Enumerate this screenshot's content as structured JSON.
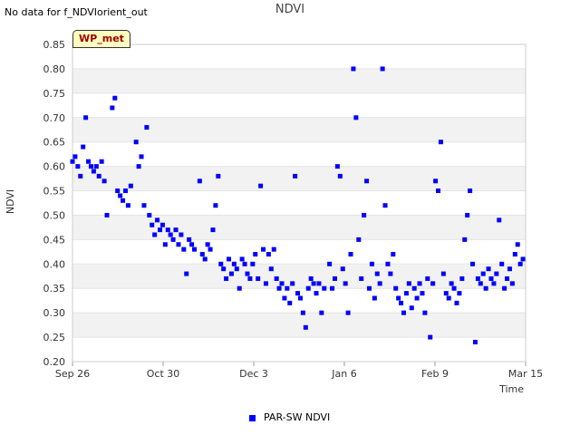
{
  "note": "No data for f_NDVIorient_out",
  "tag_label": "WP_met",
  "chart_data": {
    "type": "scatter",
    "title": "NDVI",
    "xlabel": "Time",
    "ylabel": "NDVI",
    "x_ticks": [
      "Sep 26",
      "Oct 30",
      "Dec 3",
      "Jan 6",
      "Feb 9",
      "Mar 15"
    ],
    "xlim": [
      "2023-09-26",
      "2024-03-15"
    ],
    "ylim": [
      0.2,
      0.85
    ],
    "y_ticks": [
      0.2,
      0.25,
      0.3,
      0.35,
      0.4,
      0.45,
      0.5,
      0.55,
      0.6,
      0.65,
      0.7,
      0.75,
      0.8,
      0.85
    ],
    "grid": "alternating horizontal bands",
    "legend_position": "bottom-center",
    "series": [
      {
        "name": "PAR-SW NDVI",
        "color": "#0000ff",
        "points": [
          [
            "2023-09-26",
            0.61
          ],
          [
            "2023-09-27",
            0.62
          ],
          [
            "2023-09-28",
            0.6
          ],
          [
            "2023-09-29",
            0.58
          ],
          [
            "2023-09-30",
            0.64
          ],
          [
            "2023-10-01",
            0.7
          ],
          [
            "2023-10-02",
            0.61
          ],
          [
            "2023-10-03",
            0.6
          ],
          [
            "2023-10-04",
            0.59
          ],
          [
            "2023-10-05",
            0.6
          ],
          [
            "2023-10-06",
            0.58
          ],
          [
            "2023-10-07",
            0.61
          ],
          [
            "2023-10-08",
            0.57
          ],
          [
            "2023-10-09",
            0.5
          ],
          [
            "2023-10-11",
            0.72
          ],
          [
            "2023-10-12",
            0.74
          ],
          [
            "2023-10-13",
            0.55
          ],
          [
            "2023-10-14",
            0.54
          ],
          [
            "2023-10-15",
            0.53
          ],
          [
            "2023-10-16",
            0.55
          ],
          [
            "2023-10-17",
            0.52
          ],
          [
            "2023-10-18",
            0.56
          ],
          [
            "2023-10-20",
            0.65
          ],
          [
            "2023-10-21",
            0.6
          ],
          [
            "2023-10-22",
            0.62
          ],
          [
            "2023-10-23",
            0.52
          ],
          [
            "2023-10-24",
            0.68
          ],
          [
            "2023-10-25",
            0.5
          ],
          [
            "2023-10-26",
            0.48
          ],
          [
            "2023-10-27",
            0.46
          ],
          [
            "2023-10-28",
            0.49
          ],
          [
            "2023-10-29",
            0.47
          ],
          [
            "2023-10-30",
            0.48
          ],
          [
            "2023-10-31",
            0.44
          ],
          [
            "2023-11-01",
            0.47
          ],
          [
            "2023-11-02",
            0.46
          ],
          [
            "2023-11-03",
            0.45
          ],
          [
            "2023-11-04",
            0.47
          ],
          [
            "2023-11-05",
            0.44
          ],
          [
            "2023-11-06",
            0.46
          ],
          [
            "2023-11-07",
            0.43
          ],
          [
            "2023-11-08",
            0.38
          ],
          [
            "2023-11-09",
            0.45
          ],
          [
            "2023-11-10",
            0.44
          ],
          [
            "2023-11-11",
            0.43
          ],
          [
            "2023-11-13",
            0.57
          ],
          [
            "2023-11-14",
            0.42
          ],
          [
            "2023-11-15",
            0.41
          ],
          [
            "2023-11-16",
            0.44
          ],
          [
            "2023-11-17",
            0.43
          ],
          [
            "2023-11-18",
            0.47
          ],
          [
            "2023-11-19",
            0.52
          ],
          [
            "2023-11-20",
            0.58
          ],
          [
            "2023-11-21",
            0.4
          ],
          [
            "2023-11-22",
            0.39
          ],
          [
            "2023-11-23",
            0.37
          ],
          [
            "2023-11-24",
            0.41
          ],
          [
            "2023-11-25",
            0.38
          ],
          [
            "2023-11-26",
            0.4
          ],
          [
            "2023-11-27",
            0.39
          ],
          [
            "2023-11-28",
            0.35
          ],
          [
            "2023-11-29",
            0.41
          ],
          [
            "2023-11-30",
            0.4
          ],
          [
            "2023-12-01",
            0.38
          ],
          [
            "2023-12-02",
            0.37
          ],
          [
            "2023-12-03",
            0.4
          ],
          [
            "2023-12-04",
            0.42
          ],
          [
            "2023-12-05",
            0.37
          ],
          [
            "2023-12-06",
            0.56
          ],
          [
            "2023-12-07",
            0.43
          ],
          [
            "2023-12-08",
            0.36
          ],
          [
            "2023-12-09",
            0.42
          ],
          [
            "2023-12-10",
            0.39
          ],
          [
            "2023-12-11",
            0.43
          ],
          [
            "2023-12-12",
            0.37
          ],
          [
            "2023-12-13",
            0.35
          ],
          [
            "2023-12-14",
            0.36
          ],
          [
            "2023-12-15",
            0.33
          ],
          [
            "2023-12-16",
            0.35
          ],
          [
            "2023-12-17",
            0.32
          ],
          [
            "2023-12-18",
            0.36
          ],
          [
            "2023-12-19",
            0.58
          ],
          [
            "2023-12-20",
            0.34
          ],
          [
            "2023-12-21",
            0.33
          ],
          [
            "2023-12-22",
            0.3
          ],
          [
            "2023-12-23",
            0.27
          ],
          [
            "2023-12-24",
            0.35
          ],
          [
            "2023-12-25",
            0.37
          ],
          [
            "2023-12-26",
            0.36
          ],
          [
            "2023-12-27",
            0.34
          ],
          [
            "2023-12-28",
            0.36
          ],
          [
            "2023-12-29",
            0.3
          ],
          [
            "2023-12-30",
            0.35
          ],
          [
            "2024-01-01",
            0.4
          ],
          [
            "2024-01-02",
            0.35
          ],
          [
            "2024-01-03",
            0.37
          ],
          [
            "2024-01-04",
            0.6
          ],
          [
            "2024-01-05",
            0.58
          ],
          [
            "2024-01-06",
            0.39
          ],
          [
            "2024-01-07",
            0.36
          ],
          [
            "2024-01-08",
            0.3
          ],
          [
            "2024-01-09",
            0.42
          ],
          [
            "2024-01-10",
            0.8
          ],
          [
            "2024-01-11",
            0.7
          ],
          [
            "2024-01-12",
            0.45
          ],
          [
            "2024-01-13",
            0.37
          ],
          [
            "2024-01-14",
            0.5
          ],
          [
            "2024-01-15",
            0.57
          ],
          [
            "2024-01-16",
            0.35
          ],
          [
            "2024-01-17",
            0.4
          ],
          [
            "2024-01-18",
            0.33
          ],
          [
            "2024-01-19",
            0.38
          ],
          [
            "2024-01-20",
            0.36
          ],
          [
            "2024-01-21",
            0.8
          ],
          [
            "2024-01-22",
            0.52
          ],
          [
            "2024-01-23",
            0.4
          ],
          [
            "2024-01-24",
            0.38
          ],
          [
            "2024-01-25",
            0.42
          ],
          [
            "2024-01-26",
            0.35
          ],
          [
            "2024-01-27",
            0.33
          ],
          [
            "2024-01-28",
            0.32
          ],
          [
            "2024-01-29",
            0.3
          ],
          [
            "2024-01-30",
            0.34
          ],
          [
            "2024-01-31",
            0.36
          ],
          [
            "2024-02-01",
            0.31
          ],
          [
            "2024-02-02",
            0.35
          ],
          [
            "2024-02-03",
            0.33
          ],
          [
            "2024-02-04",
            0.36
          ],
          [
            "2024-02-05",
            0.34
          ],
          [
            "2024-02-06",
            0.3
          ],
          [
            "2024-02-07",
            0.37
          ],
          [
            "2024-02-08",
            0.25
          ],
          [
            "2024-02-09",
            0.36
          ],
          [
            "2024-02-10",
            0.57
          ],
          [
            "2024-02-11",
            0.55
          ],
          [
            "2024-02-12",
            0.65
          ],
          [
            "2024-02-13",
            0.38
          ],
          [
            "2024-02-14",
            0.34
          ],
          [
            "2024-02-15",
            0.33
          ],
          [
            "2024-02-16",
            0.36
          ],
          [
            "2024-02-17",
            0.35
          ],
          [
            "2024-02-18",
            0.32
          ],
          [
            "2024-02-19",
            0.34
          ],
          [
            "2024-02-20",
            0.37
          ],
          [
            "2024-02-21",
            0.45
          ],
          [
            "2024-02-22",
            0.5
          ],
          [
            "2024-02-23",
            0.55
          ],
          [
            "2024-02-24",
            0.4
          ],
          [
            "2024-02-25",
            0.24
          ],
          [
            "2024-02-26",
            0.37
          ],
          [
            "2024-02-27",
            0.36
          ],
          [
            "2024-02-28",
            0.38
          ],
          [
            "2024-02-29",
            0.35
          ],
          [
            "2024-03-01",
            0.39
          ],
          [
            "2024-03-02",
            0.37
          ],
          [
            "2024-03-03",
            0.36
          ],
          [
            "2024-03-04",
            0.38
          ],
          [
            "2024-03-05",
            0.49
          ],
          [
            "2024-03-06",
            0.4
          ],
          [
            "2024-03-07",
            0.35
          ],
          [
            "2024-03-08",
            0.37
          ],
          [
            "2024-03-09",
            0.39
          ],
          [
            "2024-03-10",
            0.36
          ],
          [
            "2024-03-11",
            0.42
          ],
          [
            "2024-03-12",
            0.44
          ],
          [
            "2024-03-13",
            0.4
          ],
          [
            "2024-03-14",
            0.41
          ]
        ]
      }
    ]
  }
}
